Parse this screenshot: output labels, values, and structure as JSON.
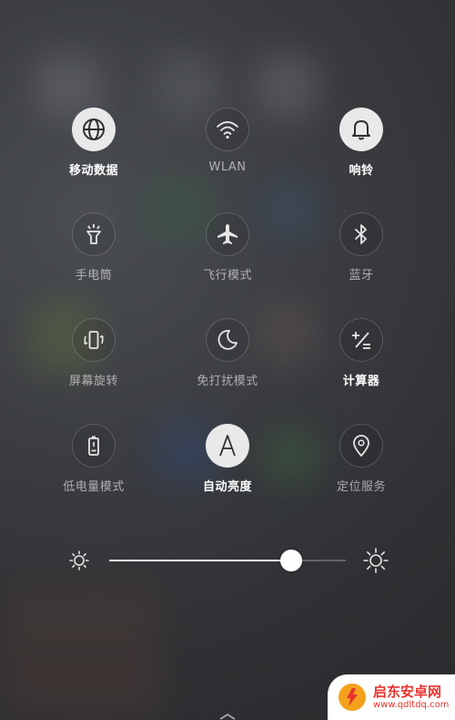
{
  "tiles": [
    {
      "id": "mobile-data",
      "label": "移动数据",
      "active": true,
      "icon": "globe-icon"
    },
    {
      "id": "wlan",
      "label": "WLAN",
      "active": false,
      "icon": "wifi-icon"
    },
    {
      "id": "ring",
      "label": "响铃",
      "active": true,
      "icon": "bell-icon"
    },
    {
      "id": "flashlight",
      "label": "手电筒",
      "active": false,
      "icon": "flashlight-icon"
    },
    {
      "id": "airplane",
      "label": "飞行模式",
      "active": false,
      "icon": "airplane-icon"
    },
    {
      "id": "bluetooth",
      "label": "蓝牙",
      "active": false,
      "icon": "bluetooth-icon"
    },
    {
      "id": "rotation",
      "label": "屏幕旋转",
      "active": false,
      "icon": "rotate-icon"
    },
    {
      "id": "dnd",
      "label": "免打扰模式",
      "active": false,
      "icon": "moon-icon"
    },
    {
      "id": "calculator",
      "label": "计算器",
      "active": true,
      "icon": "calculator-icon"
    },
    {
      "id": "power-saving",
      "label": "低电量模式",
      "active": false,
      "icon": "battery-icon"
    },
    {
      "id": "auto-brightness",
      "label": "自动亮度",
      "active": true,
      "icon": "auto-brightness-icon"
    },
    {
      "id": "location",
      "label": "定位服务",
      "active": false,
      "icon": "location-icon"
    }
  ],
  "brightness": {
    "level": 0.77
  },
  "watermark": {
    "name": "启东安卓网",
    "url": "www.qdltdq.com"
  },
  "colors": {
    "active_circle": "#e9e9ea",
    "icon_light": "#f0f0f0",
    "icon_dark": "#2e2f32",
    "watermark_red": "#e8342f"
  }
}
